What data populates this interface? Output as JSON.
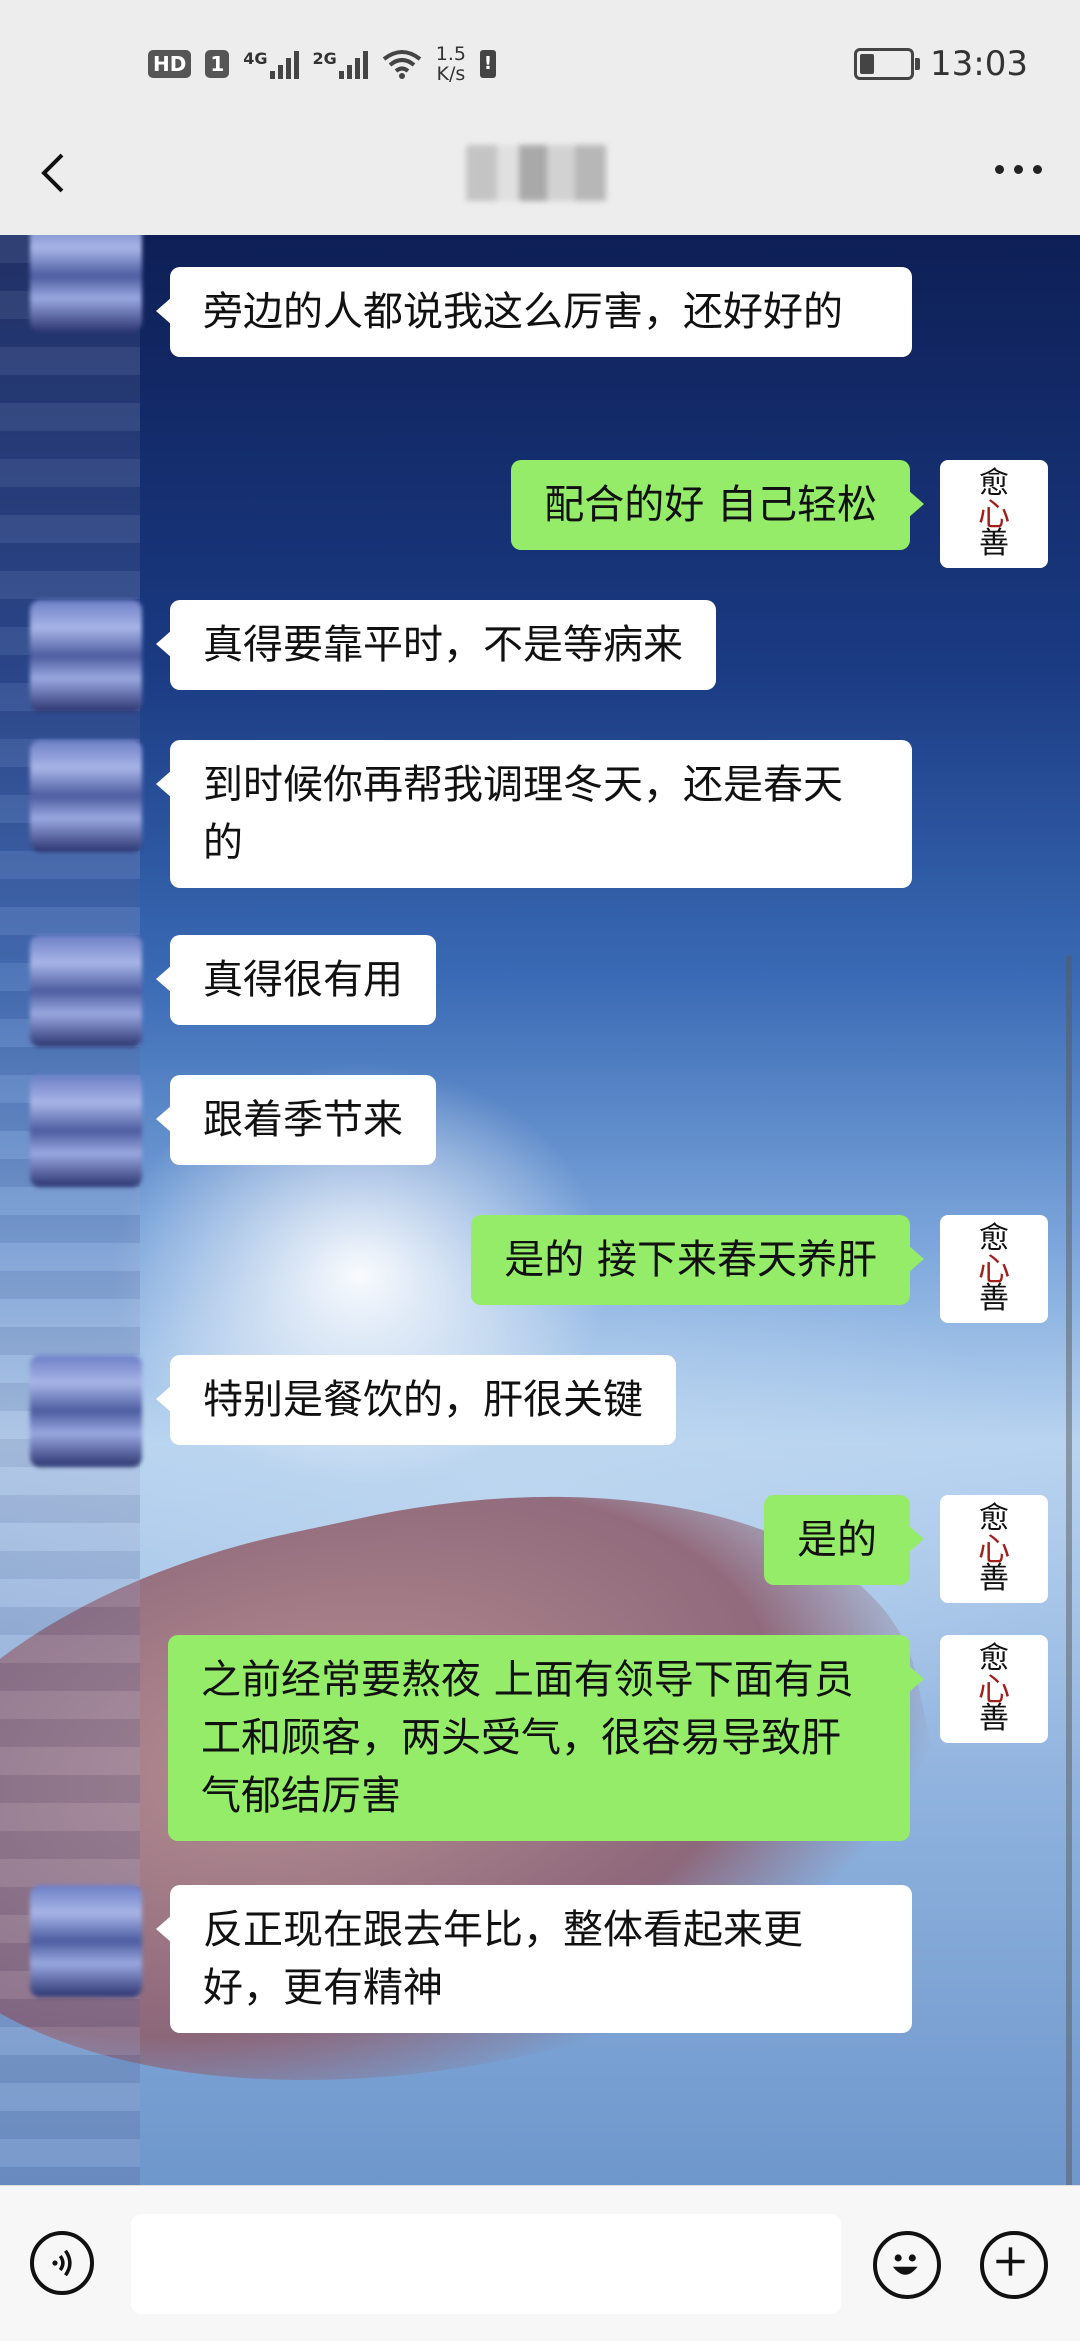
{
  "status_bar": {
    "hd_label": "HD",
    "sim_label": "1",
    "net1_label": "4G",
    "net2_label": "2G",
    "speed_value": "1.5",
    "speed_unit": "K/s",
    "time": "13:03"
  },
  "header": {
    "back_icon": "chevron-left-icon",
    "more_icon": "more-dots-icon"
  },
  "messages": [
    {
      "side": "them",
      "text": "旁边的人都说我这么厉害，还好好的"
    },
    {
      "side": "me",
      "text": "配合的好 自己轻松"
    },
    {
      "side": "them",
      "text": "真得要靠平时，不是等病来"
    },
    {
      "side": "them",
      "text": "到时候你再帮我调理冬天，还是春天的"
    },
    {
      "side": "them",
      "text": "真得很有用"
    },
    {
      "side": "them",
      "text": "跟着季节来"
    },
    {
      "side": "me",
      "text": "是的 接下来春天养肝"
    },
    {
      "side": "them",
      "text": "特别是餐饮的，肝很关键"
    },
    {
      "side": "me",
      "text": "是的"
    },
    {
      "side": "me",
      "text": "之前经常要熬夜 上面有领导下面有员工和顾客，两头受气，很容易导致肝气郁结厉害"
    },
    {
      "side": "them",
      "text": "反正现在跟去年比，整体看起来更好，更有精神"
    }
  ],
  "my_avatar": {
    "char1": "愈",
    "char2": "心",
    "char3": "善"
  },
  "colors": {
    "my_bubble": "#95ec69",
    "their_bubble": "#ffffff",
    "bar_bg": "#ededed"
  },
  "input_bar": {
    "voice_icon": "voice-icon",
    "emoji_icon": "emoji-icon",
    "plus_icon": "plus-icon",
    "placeholder": ""
  }
}
